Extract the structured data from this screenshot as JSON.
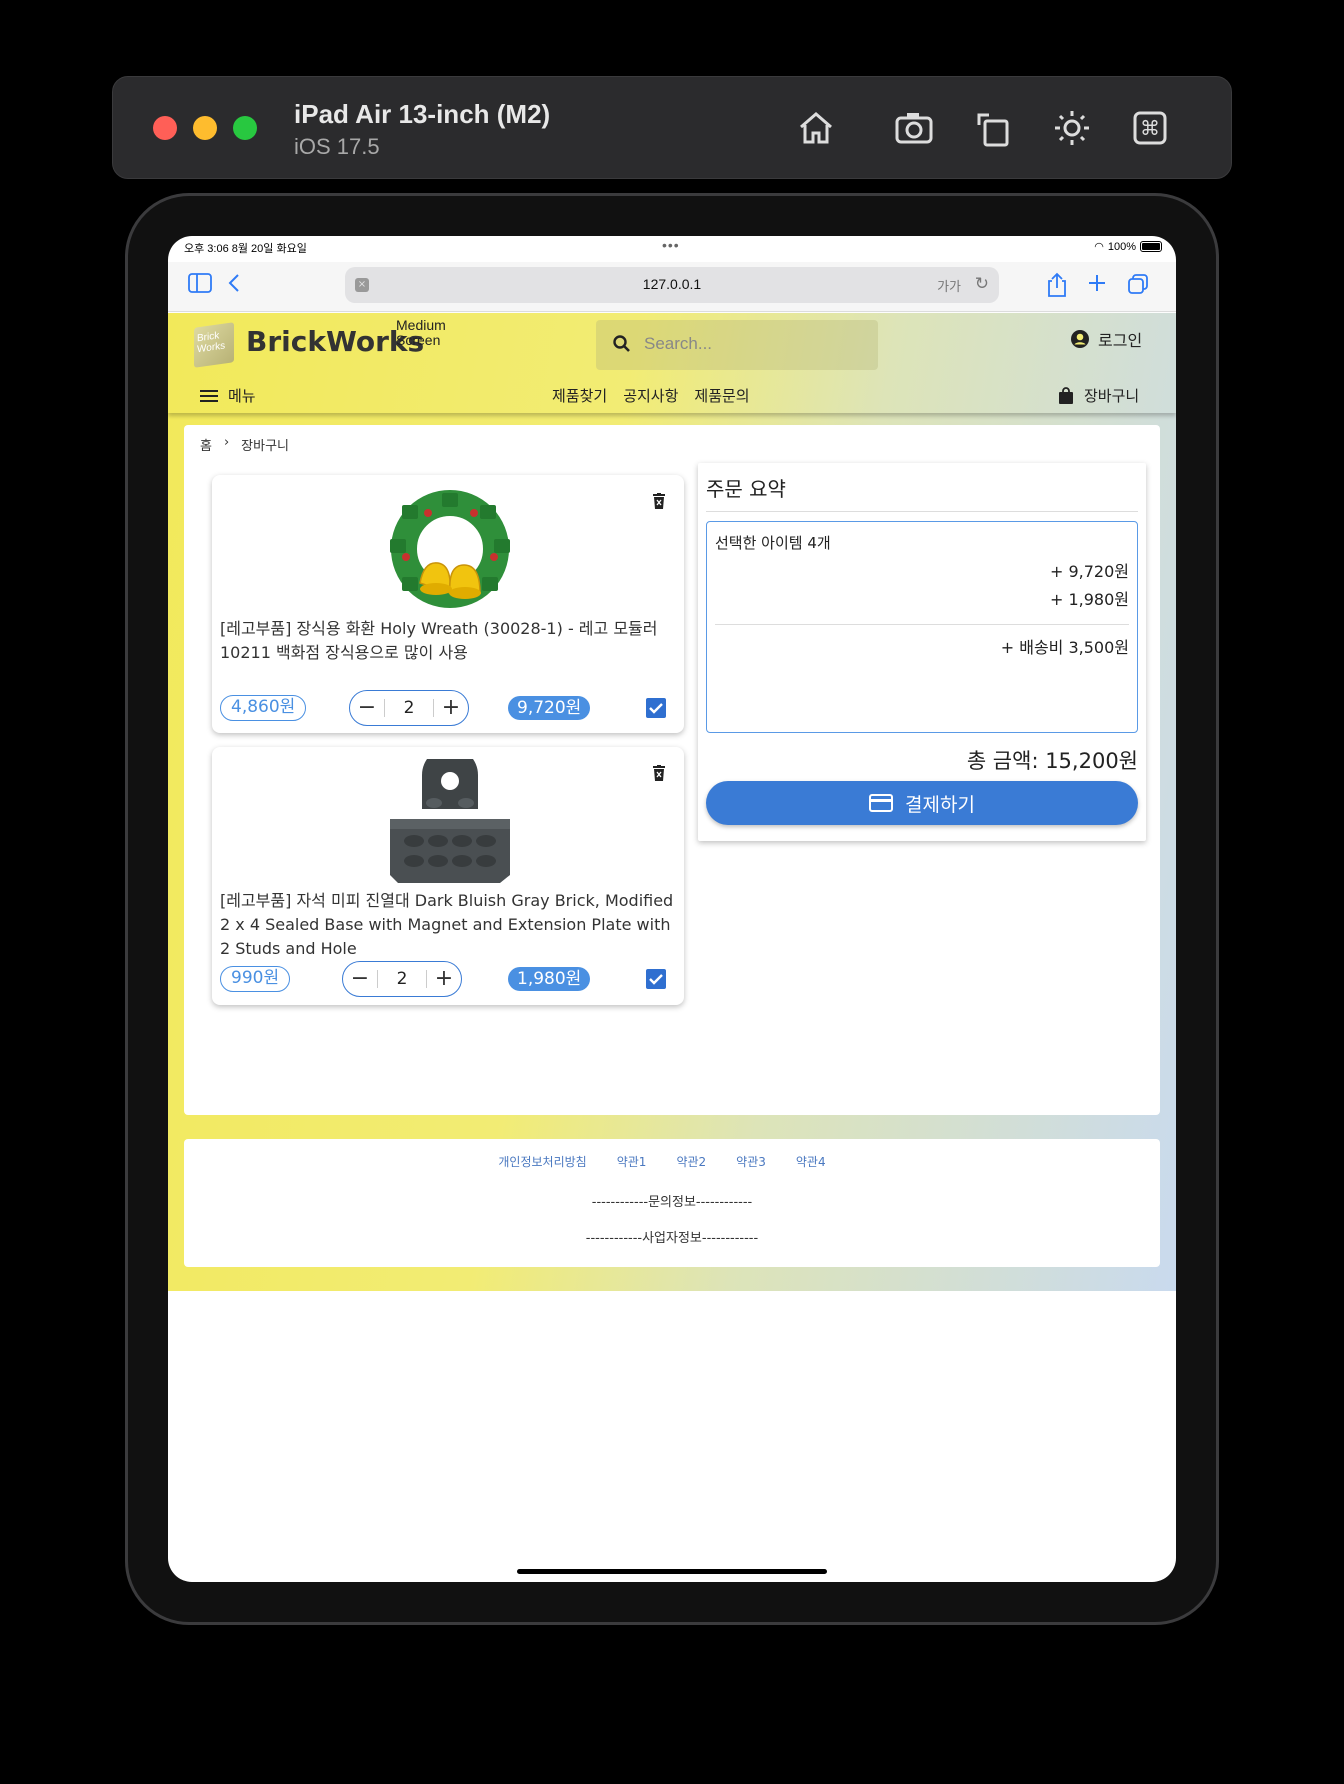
{
  "simulator": {
    "device": "iPad Air 13-inch (M2)",
    "os": "iOS 17.5",
    "icons": [
      "home-icon",
      "screenshot-icon",
      "rotate-icon",
      "brightness-icon",
      "command-icon"
    ]
  },
  "status_bar": {
    "time_date": "오후 3:06   8월 20일 화요일",
    "dots": "•••",
    "battery": "100%"
  },
  "safari": {
    "url": "127.0.0.1",
    "text_size": "가가"
  },
  "header": {
    "logo_text": "Brick Works",
    "brand": "BrickWorks",
    "brand_sub_1": "Medium",
    "brand_sub_2": "Screen",
    "search_placeholder": "Search...",
    "login": "로그인",
    "menu": "메뉴",
    "nav": [
      "제품찾기",
      "공지사항",
      "제품문의"
    ],
    "cart": "장바구니"
  },
  "breadcrumb": {
    "home": "홈",
    "sep": "›",
    "current": "장바구니"
  },
  "cart_items": [
    {
      "title": "[레고부품] 장식용 화환 Holy Wreath (30028-1) - 레고 모듈러 10211 백화점 장식용으로 많이 사용",
      "unit_price": "4,860원",
      "qty": "2",
      "subtotal": "9,720원",
      "checked": true
    },
    {
      "title": "[레고부품] 자석 미피 진열대 Dark Bluish Gray Brick, Modified 2 x 4 Sealed Base with Magnet and Extension Plate with 2 Studs and Hole",
      "unit_price": "990원",
      "qty": "2",
      "subtotal": "1,980원",
      "checked": true
    }
  ],
  "summary": {
    "heading": "주문 요약",
    "selected": "선택한 아이템 4개",
    "lines": [
      "+ 9,720원",
      "+ 1,980원"
    ],
    "shipping": "+ 배송비 3,500원",
    "total": "총 금액: 15,200원",
    "pay": "결제하기"
  },
  "footer": {
    "links": [
      "개인정보처리방침",
      "약관1",
      "약관2",
      "약관3",
      "약관4"
    ],
    "contact": "------------문의정보------------",
    "business": "------------사업자정보------------"
  },
  "colors": {
    "accent": "#3a7bd5",
    "header_yellow": "#f2e95a",
    "header_blue": "#c9daee"
  }
}
